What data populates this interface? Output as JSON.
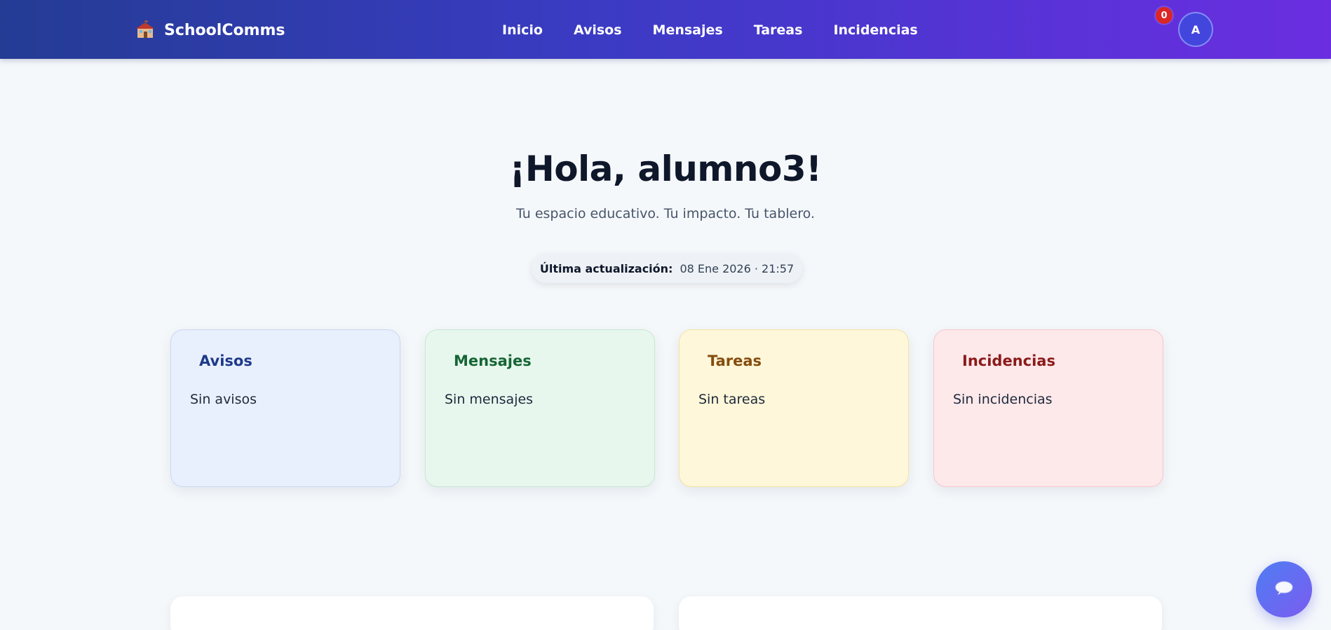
{
  "header": {
    "brand_name": "SchoolComms",
    "brand_icon": "school-icon",
    "nav": [
      "Inicio",
      "Avisos",
      "Mensajes",
      "Tareas",
      "Incidencias"
    ],
    "notification_count": "0",
    "avatar_initial": "A"
  },
  "hero": {
    "greeting": "¡Hola, alumno3!",
    "subtitle": "Tu espacio educativo. Tu impacto. Tu tablero.",
    "last_update_label": "Última actualización:",
    "last_update_value": "08 Ene 2026 · 21:57"
  },
  "cards": [
    {
      "title": "Avisos",
      "empty_text": "Sin avisos",
      "accent": "#1e3a8a"
    },
    {
      "title": "Mensajes",
      "empty_text": "Sin mensajes",
      "accent": "#166534"
    },
    {
      "title": "Tareas",
      "empty_text": "Sin tareas",
      "accent": "#854d0e"
    },
    {
      "title": "Incidencias",
      "empty_text": "Sin incidencias",
      "accent": "#8b1a1a"
    }
  ],
  "chat": {
    "icon": "chat-bubble-icon"
  },
  "colors": {
    "header_start": "#243c94",
    "header_end": "#6a2ee0",
    "badge": "#dc2626",
    "background": "#f5f8fb"
  }
}
